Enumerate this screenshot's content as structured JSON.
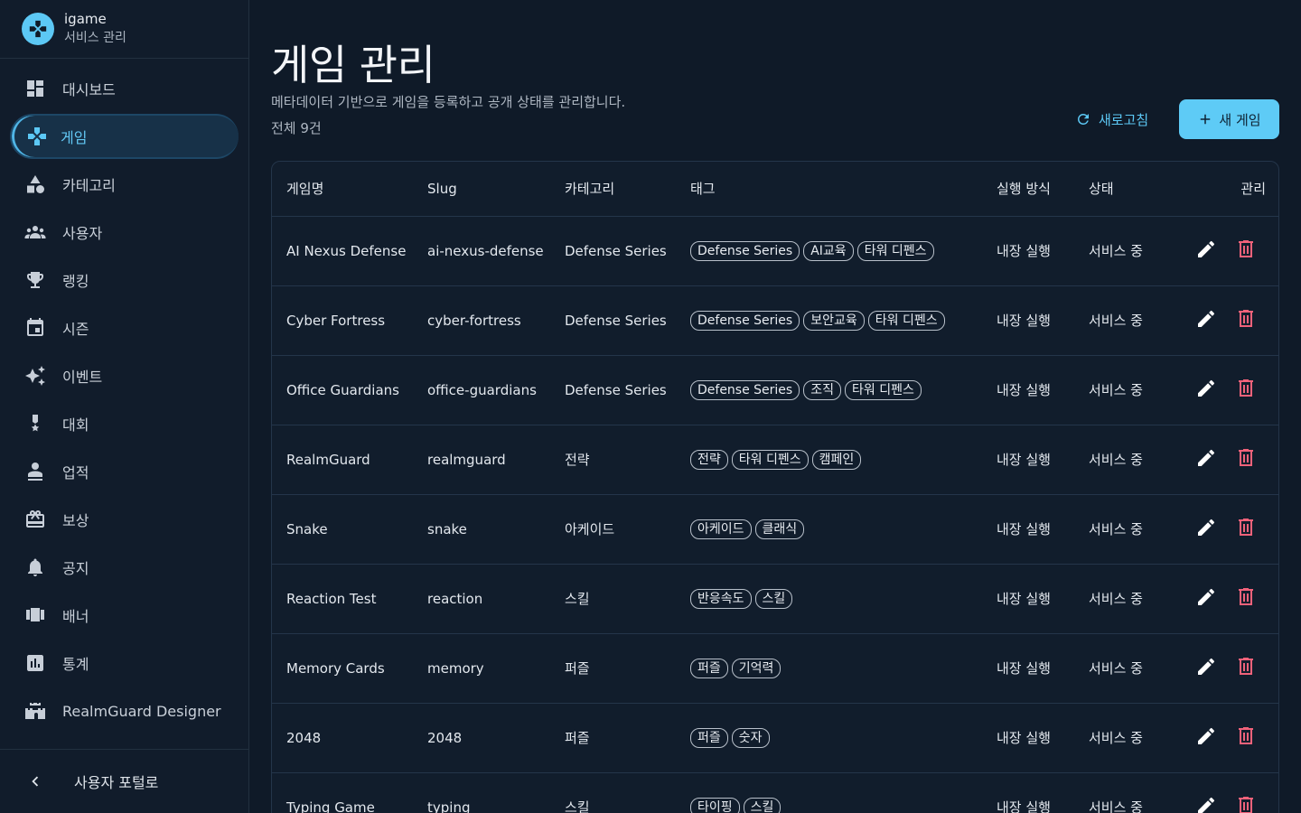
{
  "brand": {
    "name": "igame",
    "subtitle": "서비스 관리"
  },
  "sidebar": {
    "items": [
      {
        "label": "대시보드",
        "icon": "dashboard-icon",
        "active": false
      },
      {
        "label": "게임",
        "icon": "gamepad-icon",
        "active": true
      },
      {
        "label": "카테고리",
        "icon": "category-icon",
        "active": false
      },
      {
        "label": "사용자",
        "icon": "users-icon",
        "active": false
      },
      {
        "label": "랭킹",
        "icon": "trophy-icon",
        "active": false
      },
      {
        "label": "시즌",
        "icon": "calendar-icon",
        "active": false
      },
      {
        "label": "이벤트",
        "icon": "sparkle-icon",
        "active": false
      },
      {
        "label": "대회",
        "icon": "medal-icon",
        "active": false
      },
      {
        "label": "업적",
        "icon": "achievement-icon",
        "active": false
      },
      {
        "label": "보상",
        "icon": "gift-icon",
        "active": false
      },
      {
        "label": "공지",
        "icon": "bell-icon",
        "active": false
      },
      {
        "label": "배너",
        "icon": "banner-icon",
        "active": false
      },
      {
        "label": "통계",
        "icon": "stats-icon",
        "active": false
      },
      {
        "label": "RealmGuard Designer",
        "icon": "castle-icon",
        "active": false
      }
    ],
    "footer_label": "사용자 포털로"
  },
  "header": {
    "title": "게임 관리",
    "description": "메타데이터 기반으로 게임을 등록하고 공개 상태를 관리합니다.",
    "count": "전체 9건",
    "refresh_label": "새로고침",
    "new_label": "새 게임"
  },
  "table": {
    "columns": [
      "게임명",
      "Slug",
      "카테고리",
      "태그",
      "실행 방식",
      "상태",
      "관리"
    ],
    "rows": [
      {
        "name": "AI Nexus Defense",
        "slug": "ai-nexus-defense",
        "category": "Defense Series",
        "tags": [
          "Defense Series",
          "AI교육",
          "타워 디펜스"
        ],
        "mode": "내장 실행",
        "status": "서비스 중"
      },
      {
        "name": "Cyber Fortress",
        "slug": "cyber-fortress",
        "category": "Defense Series",
        "tags": [
          "Defense Series",
          "보안교육",
          "타워 디펜스"
        ],
        "mode": "내장 실행",
        "status": "서비스 중"
      },
      {
        "name": "Office Guardians",
        "slug": "office-guardians",
        "category": "Defense Series",
        "tags": [
          "Defense Series",
          "조직",
          "타워 디펜스"
        ],
        "mode": "내장 실행",
        "status": "서비스 중"
      },
      {
        "name": "RealmGuard",
        "slug": "realmguard",
        "category": "전략",
        "tags": [
          "전략",
          "타워 디펜스",
          "캠페인"
        ],
        "mode": "내장 실행",
        "status": "서비스 중"
      },
      {
        "name": "Snake",
        "slug": "snake",
        "category": "아케이드",
        "tags": [
          "아케이드",
          "클래식"
        ],
        "mode": "내장 실행",
        "status": "서비스 중"
      },
      {
        "name": "Reaction Test",
        "slug": "reaction",
        "category": "스킬",
        "tags": [
          "반응속도",
          "스킬"
        ],
        "mode": "내장 실행",
        "status": "서비스 중"
      },
      {
        "name": "Memory Cards",
        "slug": "memory",
        "category": "퍼즐",
        "tags": [
          "퍼즐",
          "기억력"
        ],
        "mode": "내장 실행",
        "status": "서비스 중"
      },
      {
        "name": "2048",
        "slug": "2048",
        "category": "퍼즐",
        "tags": [
          "퍼즐",
          "숫자"
        ],
        "mode": "내장 실행",
        "status": "서비스 중"
      },
      {
        "name": "Typing Game",
        "slug": "typing",
        "category": "스킬",
        "tags": [
          "타이핑",
          "스킬"
        ],
        "mode": "내장 실행",
        "status": "서비스 중"
      }
    ]
  },
  "colors": {
    "accent": "#5ecbf6",
    "danger": "#f0627a",
    "background": "#0f1a28"
  }
}
